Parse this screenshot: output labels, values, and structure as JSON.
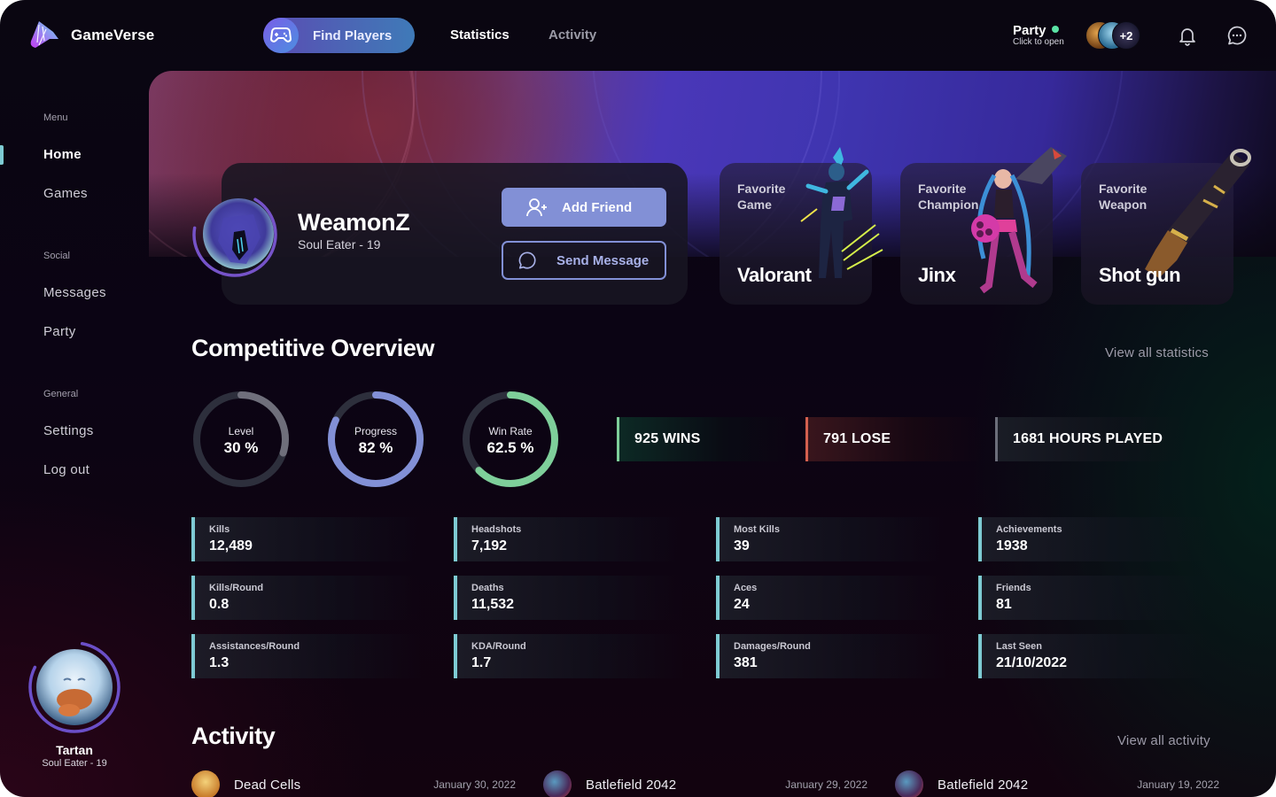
{
  "app": {
    "brand": "GameVerse"
  },
  "topnav": {
    "find_players": "Find Players",
    "statistics": "Statistics",
    "activity": "Activity",
    "party_title": "Party",
    "party_subtitle": "Click to open",
    "party_extra_count": "+2",
    "party_status_color": "#5be3a5"
  },
  "sidebar": {
    "sections": [
      {
        "title": "Menu",
        "items": [
          {
            "label": "Home",
            "active": true
          },
          {
            "label": "Games"
          }
        ]
      },
      {
        "title": "Social",
        "items": [
          {
            "label": "Messages"
          },
          {
            "label": "Party"
          }
        ]
      },
      {
        "title": "General",
        "items": [
          {
            "label": "Settings"
          },
          {
            "label": "Log out"
          }
        ]
      }
    ],
    "current_user": {
      "name": "Tartan",
      "subtitle": "Soul Eater - 19"
    }
  },
  "profile": {
    "name": "WeamonZ",
    "subtitle": "Soul Eater - 19",
    "add_friend": "Add Friend",
    "send_message": "Send Message"
  },
  "favorites": [
    {
      "label_line1": "Favorite",
      "label_line2": "Game",
      "value": "Valorant"
    },
    {
      "label_line1": "Favorite",
      "label_line2": "Champion",
      "value": "Jinx"
    },
    {
      "label_line1": "Favorite",
      "label_line2": "Weapon",
      "value": "Shot gun"
    }
  ],
  "overview": {
    "title": "Competitive Overview",
    "view_all": "View all statistics",
    "rings": [
      {
        "label": "Level",
        "display": "30 %",
        "percent": 30,
        "color": "#6f6f7b"
      },
      {
        "label": "Progress",
        "display": "82 %",
        "percent": 82,
        "color": "#8290d6"
      },
      {
        "label": "Win Rate",
        "display": "62.5 %",
        "percent": 62.5,
        "color": "#7ecf9a"
      }
    ],
    "summary": [
      {
        "text": "925 WINS",
        "color": "#7ecf9a"
      },
      {
        "text": "791 LOSE",
        "color": "#d4604f"
      },
      {
        "text": "1681 HOURS PLAYED",
        "color": "#6c6e7a"
      }
    ],
    "stats": [
      {
        "label": "Kills",
        "value": "12,489"
      },
      {
        "label": "Headshots",
        "value": "7,192"
      },
      {
        "label": "Most Kills",
        "value": "39"
      },
      {
        "label": "Achievements",
        "value": "1938"
      },
      {
        "label": "Kills/Round",
        "value": "0.8"
      },
      {
        "label": "Deaths",
        "value": "11,532"
      },
      {
        "label": "Aces",
        "value": "24"
      },
      {
        "label": "Friends",
        "value": "81"
      },
      {
        "label": "Assistances/Round",
        "value": "1.3"
      },
      {
        "label": "KDA/Round",
        "value": "1.7"
      },
      {
        "label": "Damages/Round",
        "value": "381"
      },
      {
        "label": "Last Seen",
        "value": "21/10/2022"
      }
    ]
  },
  "activity": {
    "title": "Activity",
    "view_all": "View all activity",
    "items": [
      {
        "game": "Dead Cells",
        "date": "January 30, 2022"
      },
      {
        "game": "Batlefield 2042",
        "date": "January 29, 2022"
      },
      {
        "game": "Batlefield 2042",
        "date": "January 19, 2022"
      }
    ]
  }
}
